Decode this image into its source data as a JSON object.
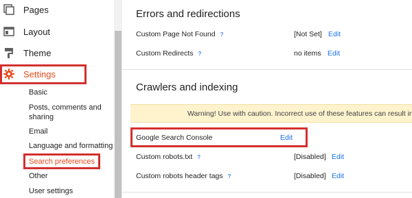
{
  "sidebar": {
    "items": [
      {
        "label": "Pages",
        "icon": "pages-icon"
      },
      {
        "label": "Layout",
        "icon": "layout-icon"
      },
      {
        "label": "Theme",
        "icon": "theme-icon"
      },
      {
        "label": "Settings",
        "icon": "gear-icon"
      }
    ],
    "sub_items": [
      "Basic",
      "Posts, comments and",
      "sharing",
      "Email",
      "Language and formatting",
      "Search preferences",
      "Other",
      "User settings"
    ]
  },
  "main": {
    "errors_section": {
      "title": "Errors and redirections",
      "rows": [
        {
          "name": "Custom Page Not Found",
          "value": "[Not Set]",
          "edit": "Edit"
        },
        {
          "name": "Custom Redirects",
          "value": "no items",
          "edit": "Edit"
        }
      ]
    },
    "crawlers_section": {
      "title": "Crawlers and indexing",
      "warning": "Warning! Use with caution. Incorrect use of these features can result in yo",
      "rows": [
        {
          "name": "Google Search Console",
          "value": "",
          "edit": "Edit"
        },
        {
          "name": "Custom robots.txt",
          "value": "[Disabled]",
          "edit": "Edit"
        },
        {
          "name": "Custom robots header tags",
          "value": "[Disabled]",
          "edit": "Edit"
        }
      ]
    },
    "help_glyph": "?"
  },
  "colors": {
    "accent": "#e64a19",
    "highlight_box": "#d32f2f",
    "link": "#1a73e8",
    "warning_bg": "#fff3cd"
  }
}
